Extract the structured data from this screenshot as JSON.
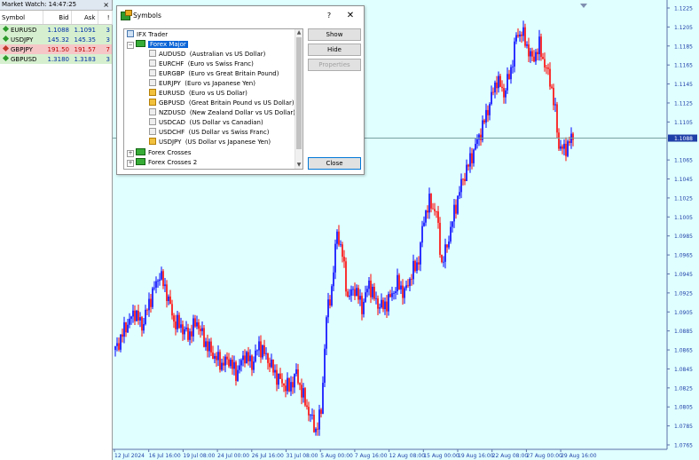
{
  "market_watch": {
    "title": "Market Watch: 14:47:25",
    "close_label": "×",
    "columns": [
      "Symbol",
      "Bid",
      "Ask",
      "!"
    ],
    "rows": [
      {
        "symbol": "EURUSD",
        "bid": "1.1088",
        "ask": "1.1091",
        "spread": "3",
        "status": "green"
      },
      {
        "symbol": "USDJPY",
        "bid": "145.32",
        "ask": "145.35",
        "spread": "3",
        "status": "green"
      },
      {
        "symbol": "GBPJPY",
        "bid": "191.50",
        "ask": "191.57",
        "spread": "7",
        "status": "red"
      },
      {
        "symbol": "GBPUSD",
        "bid": "1.3180",
        "ask": "1.3183",
        "spread": "3",
        "status": "green"
      }
    ],
    "colors": {
      "green": "#2c9a2c",
      "red": "#c0392b"
    }
  },
  "dialog": {
    "title": "Symbols",
    "help_label": "?",
    "close_label": "✕",
    "tree": {
      "root": "IFX Trader",
      "groups": [
        {
          "label": "Forex Major",
          "expanded": true,
          "selected": true
        },
        {
          "label": "Forex Crosses",
          "expanded": false
        },
        {
          "label": "Forex Crosses 2",
          "expanded": false
        }
      ],
      "symbols": [
        {
          "name": "AUDUSD",
          "desc": "(Australian vs US Dollar)",
          "icon": "gray"
        },
        {
          "name": "EURCHF",
          "desc": "(Euro vs Swiss Franc)",
          "icon": "gray"
        },
        {
          "name": "EURGBP",
          "desc": "(Euro vs Great Britain Pound)",
          "icon": "gray"
        },
        {
          "name": "EURJPY",
          "desc": "(Euro vs Japanese Yen)",
          "icon": "gray"
        },
        {
          "name": "EURUSD",
          "desc": "(Euro vs US Dollar)",
          "icon": "gold"
        },
        {
          "name": "GBPUSD",
          "desc": "(Great Britain Pound vs US Dollar)",
          "icon": "gold"
        },
        {
          "name": "NZDUSD",
          "desc": "(New Zealand Dollar vs US Dollar)",
          "icon": "gray"
        },
        {
          "name": "USDCAD",
          "desc": "(US Dollar vs Canadian)",
          "icon": "gray"
        },
        {
          "name": "USDCHF",
          "desc": "(US Dollar vs Swiss Franc)",
          "icon": "gray"
        },
        {
          "name": "USDJPY",
          "desc": "(US Dollar vs Japanese Yen)",
          "icon": "gold"
        }
      ]
    },
    "buttons": {
      "show": "Show",
      "hide": "Hide",
      "properties": "Properties",
      "close": "Close"
    }
  },
  "chart": {
    "symbol": "EURUSD",
    "current_price": "1.1088",
    "price_labels": [
      "1.1225",
      "1.1205",
      "1.1185",
      "1.1165",
      "1.1145",
      "1.1125",
      "1.1105",
      "1.1065",
      "1.1045",
      "1.1025",
      "1.1005",
      "1.0985",
      "1.0965",
      "1.0945",
      "1.0925",
      "1.0905",
      "1.0885",
      "1.0865",
      "1.0845",
      "1.0825",
      "1.0805",
      "1.0785",
      "1.0765"
    ],
    "time_labels": [
      "12 Jul 2024",
      "16 Jul 16:00",
      "19 Jul 08:00",
      "24 Jul 00:00",
      "26 Jul 16:00",
      "31 Jul 08:00",
      "5 Aug 00:00",
      "7 Aug 16:00",
      "12 Aug 08:00",
      "15 Aug 00:00",
      "19 Aug 16:00",
      "22 Aug 08:00",
      "27 Aug 00:00",
      "29 Aug 16:00"
    ],
    "colors": {
      "background": "#e0ffff",
      "bull": "#0000ff",
      "bear": "#ff0000",
      "axis_text": "#1f3fa8",
      "price_line": "#7aa0a0",
      "price_tag": "#1f3fa8"
    },
    "price_path": [
      [
        0,
        1.0865
      ],
      [
        12,
        1.089
      ],
      [
        22,
        1.0905
      ],
      [
        30,
        1.089
      ],
      [
        40,
        1.092
      ],
      [
        50,
        1.0945
      ],
      [
        58,
        1.0925
      ],
      [
        66,
        1.0895
      ],
      [
        74,
        1.089
      ],
      [
        82,
        1.088
      ],
      [
        92,
        1.0895
      ],
      [
        100,
        1.0875
      ],
      [
        110,
        1.086
      ],
      [
        120,
        1.085
      ],
      [
        128,
        1.0855
      ],
      [
        136,
        1.084
      ],
      [
        146,
        1.086
      ],
      [
        154,
        1.085
      ],
      [
        162,
        1.087
      ],
      [
        172,
        1.0855
      ],
      [
        180,
        1.084
      ],
      [
        188,
        1.083
      ],
      [
        196,
        1.0825
      ],
      [
        204,
        1.084
      ],
      [
        212,
        1.0815
      ],
      [
        220,
        1.0795
      ],
      [
        226,
        1.078
      ],
      [
        232,
        1.08
      ],
      [
        238,
        1.09
      ],
      [
        244,
        1.093
      ],
      [
        250,
        1.099
      ],
      [
        256,
        1.0965
      ],
      [
        262,
        1.092
      ],
      [
        270,
        1.093
      ],
      [
        278,
        1.091
      ],
      [
        286,
        1.0935
      ],
      [
        294,
        1.0915
      ],
      [
        302,
        1.091
      ],
      [
        310,
        1.092
      ],
      [
        318,
        1.0935
      ],
      [
        326,
        1.0925
      ],
      [
        334,
        1.0945
      ],
      [
        342,
        1.096
      ],
      [
        348,
        1.1005
      ],
      [
        354,
        1.102
      ],
      [
        362,
        1.101
      ],
      [
        368,
        1.0955
      ],
      [
        374,
        1.0975
      ],
      [
        382,
        1.101
      ],
      [
        390,
        1.104
      ],
      [
        398,
        1.106
      ],
      [
        406,
        1.108
      ],
      [
        414,
        1.11
      ],
      [
        422,
        1.1125
      ],
      [
        430,
        1.115
      ],
      [
        438,
        1.1135
      ],
      [
        446,
        1.116
      ],
      [
        452,
        1.1195
      ],
      [
        458,
        1.12
      ],
      [
        464,
        1.1185
      ],
      [
        470,
        1.117
      ],
      [
        478,
        1.1185
      ],
      [
        484,
        1.1165
      ],
      [
        490,
        1.115
      ],
      [
        496,
        1.1115
      ],
      [
        500,
        1.108
      ],
      [
        506,
        1.1075
      ],
      [
        512,
        1.1085
      ],
      [
        516,
        1.1088
      ]
    ]
  }
}
